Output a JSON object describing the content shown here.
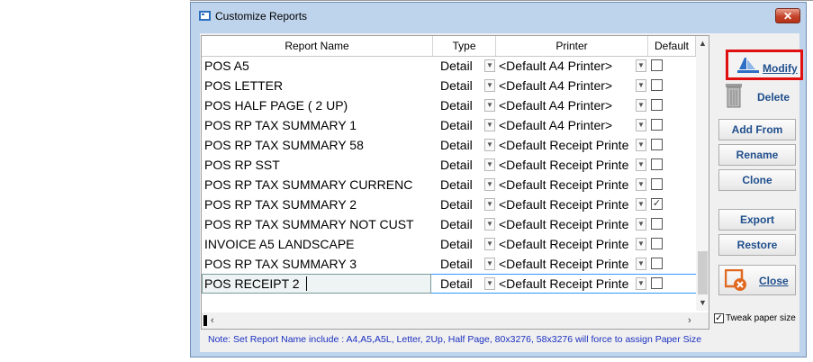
{
  "window": {
    "title": "Customize Reports",
    "close_glyph": "✕"
  },
  "grid": {
    "columns": [
      "Report Name",
      "Type",
      "Printer",
      "Default"
    ],
    "rows": [
      {
        "name": "POS A5",
        "type": "Detail",
        "printer": "<Default A4  Printer>",
        "default": false
      },
      {
        "name": "POS LETTER",
        "type": "Detail",
        "printer": "<Default A4  Printer>",
        "default": false
      },
      {
        "name": "POS HALF PAGE ( 2 UP)",
        "type": "Detail",
        "printer": "<Default A4  Printer>",
        "default": false
      },
      {
        "name": "POS RP TAX SUMMARY 1",
        "type": "Detail",
        "printer": "<Default A4  Printer>",
        "default": false
      },
      {
        "name": "POS RP TAX SUMMARY 58",
        "type": "Detail",
        "printer": "<Default Receipt Printe",
        "default": false
      },
      {
        "name": "POS RP SST",
        "type": "Detail",
        "printer": "<Default Receipt Printe",
        "default": false
      },
      {
        "name": "POS RP TAX SUMMARY CURRENC",
        "type": "Detail",
        "printer": "<Default Receipt Printe",
        "default": false
      },
      {
        "name": "POS RP TAX SUMMARY 2",
        "type": "Detail",
        "printer": "<Default Receipt Printe",
        "default": true
      },
      {
        "name": "POS RP TAX SUMMARY NOT CUST",
        "type": "Detail",
        "printer": "<Default Receipt Printe",
        "default": false
      },
      {
        "name": "INVOICE A5 LANDSCAPE",
        "type": "Detail",
        "printer": "<Default Receipt Printe",
        "default": false
      },
      {
        "name": "POS RP TAX SUMMARY 3",
        "type": "Detail",
        "printer": "<Default Receipt Printe",
        "default": false
      },
      {
        "name": "POS RECEIPT 2",
        "type": "Detail",
        "printer": "<Default Receipt Printe",
        "default": false,
        "selected": true
      }
    ]
  },
  "buttons": {
    "modify": "Modify",
    "delete": "Delete",
    "add_from": "Add From",
    "rename": "Rename",
    "clone": "Clone",
    "export": "Export",
    "restore": "Restore",
    "close": "Close"
  },
  "tweak_paper_size": {
    "label": "Tweak paper size",
    "checked": true
  },
  "note": "Note: Set Report Name include : A4,A5,A5L, Letter, 2Up, Half Page, 80x3276,  58x3276 will force to assign Paper Size",
  "colors": {
    "highlight_border": "#e01010",
    "note_text": "#1a2fbf",
    "button_text": "#1f4e8c"
  }
}
